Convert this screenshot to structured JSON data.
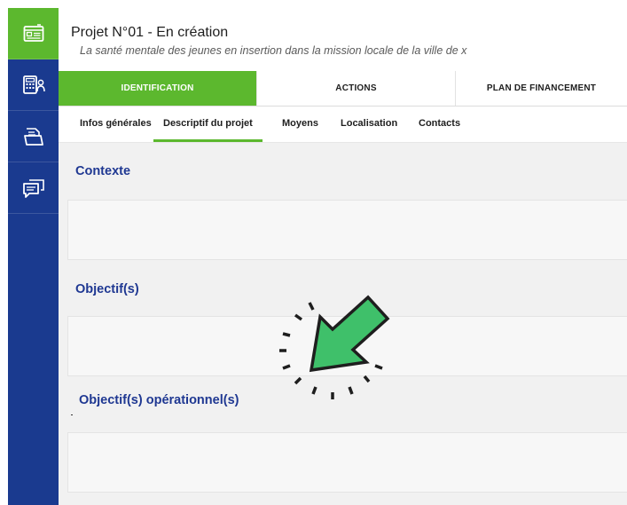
{
  "project": {
    "title": "Projet N°01 - En création",
    "subtitle": "La santé mentale des jeunes en insertion dans la mission locale de la ville de x"
  },
  "tabs": [
    {
      "label": "IDENTIFICATION",
      "active": true
    },
    {
      "label": "ACTIONS",
      "active": false
    },
    {
      "label": "PLAN DE FINANCEMENT",
      "active": false
    }
  ],
  "subtabs": [
    {
      "label": "Infos générales",
      "active": false
    },
    {
      "label": "Descriptif du projet",
      "active": true
    },
    {
      "label": "Moyens",
      "active": false
    },
    {
      "label": "Localisation",
      "active": false
    },
    {
      "label": "Contacts",
      "active": false
    }
  ],
  "sections": [
    {
      "title": "Contexte"
    },
    {
      "title": "Objectif(s)"
    },
    {
      "title": "Objectif(s) opérationnel(s)"
    }
  ],
  "sidebar": {
    "items": [
      {
        "icon": "project-card-icon",
        "active": true
      },
      {
        "icon": "calculator-user-icon",
        "active": false
      },
      {
        "icon": "folder-documents-icon",
        "active": false
      },
      {
        "icon": "chat-bubbles-icon",
        "active": false
      }
    ]
  },
  "colors": {
    "sidebar": "#1a3a8f",
    "accent_green": "#5cb82e",
    "section_title": "#1f3892",
    "cursor": "#3fc06a"
  }
}
